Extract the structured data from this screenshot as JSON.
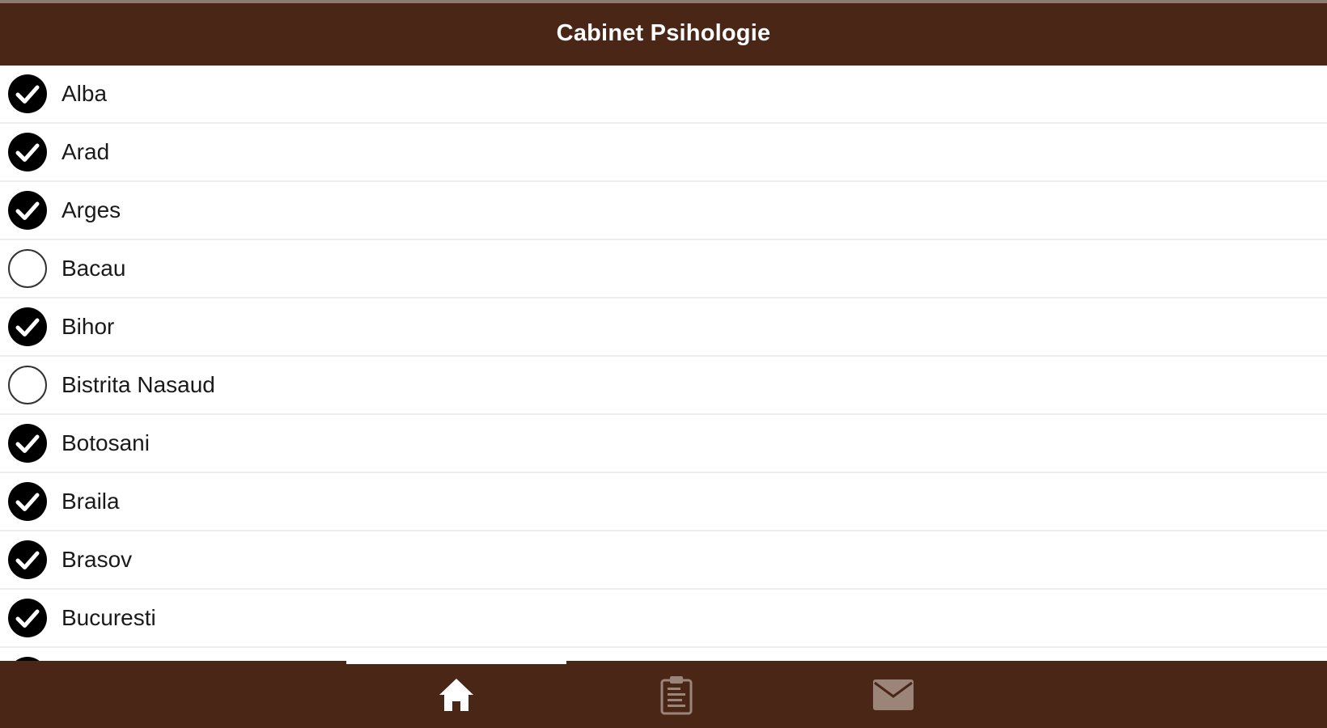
{
  "header": {
    "title": "Cabinet Psihologie"
  },
  "list": {
    "items": [
      {
        "label": "Alba",
        "checked": true
      },
      {
        "label": "Arad",
        "checked": true
      },
      {
        "label": "Arges",
        "checked": true
      },
      {
        "label": "Bacau",
        "checked": false
      },
      {
        "label": "Bihor",
        "checked": true
      },
      {
        "label": "Bistrita Nasaud",
        "checked": false
      },
      {
        "label": "Botosani",
        "checked": true
      },
      {
        "label": "Braila",
        "checked": true
      },
      {
        "label": "Brasov",
        "checked": true
      },
      {
        "label": "Bucuresti",
        "checked": true
      }
    ]
  },
  "tabbar": {
    "tabs": [
      {
        "icon": "home-icon",
        "active": true
      },
      {
        "icon": "clipboard-icon",
        "active": false
      },
      {
        "icon": "mail-icon",
        "active": false
      }
    ]
  },
  "colors": {
    "bar": "#4a2616",
    "active_icon": "#ffffff",
    "inactive_icon": "#9b8478"
  }
}
